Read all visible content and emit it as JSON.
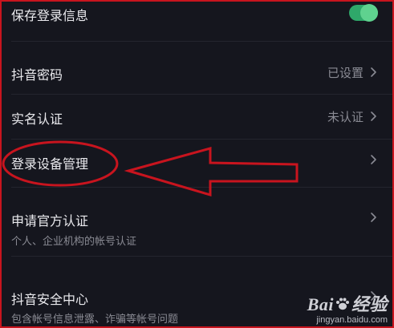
{
  "settings": {
    "save_login": {
      "label": "保存登录信息",
      "enabled": true
    },
    "password": {
      "label": "抖音密码",
      "value": "已设置"
    },
    "real_name": {
      "label": "实名认证",
      "value": "未认证"
    },
    "device_management": {
      "label": "登录设备管理"
    },
    "official_cert": {
      "label": "申请官方认证",
      "subtitle": "个人、企业机构的帐号认证"
    },
    "security_center": {
      "label": "抖音安全中心",
      "subtitle": "包含帐号信息泄露、诈骗等帐号问题"
    }
  },
  "watermark": {
    "brand": "Bai",
    "brand_suffix": "经验",
    "site": "jingyan.baidu.com"
  },
  "colors": {
    "background": "#15161e",
    "toggle_on": "#2fa86a",
    "annotation": "#c8141e"
  }
}
